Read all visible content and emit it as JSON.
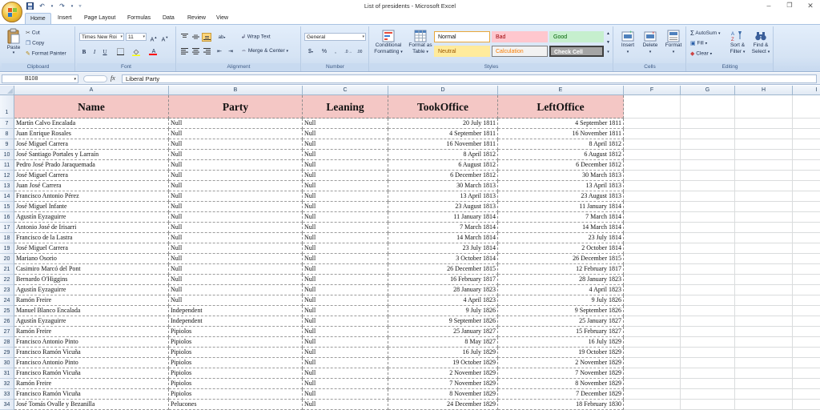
{
  "app": {
    "title": "List of presidents - Microsoft Excel"
  },
  "qat": {
    "save_icon": "save-icon",
    "undo_icon": "undo-icon",
    "redo_icon": "redo-icon"
  },
  "tabs": [
    "Home",
    "Insert",
    "Page Layout",
    "Formulas",
    "Data",
    "Review",
    "View"
  ],
  "ribbon": {
    "clipboard": {
      "label": "Clipboard",
      "paste": "Paste",
      "cut": "Cut",
      "copy": "Copy",
      "format_painter": "Format Painter"
    },
    "font": {
      "label": "Font",
      "font_name": "Times New Roi",
      "font_size": "11"
    },
    "alignment": {
      "label": "Alignment",
      "wrap_text": "Wrap Text",
      "merge_center": "Merge & Center"
    },
    "number": {
      "label": "Number",
      "format": "General"
    },
    "styles": {
      "label": "Styles",
      "conditional_formatting_1": "Conditional",
      "conditional_formatting_2": "Formatting",
      "format_as_table_1": "Format as",
      "format_as_table_2": "Table",
      "normal": "Normal",
      "bad": "Bad",
      "good": "Good",
      "neutral": "Neutral",
      "calculation": "Calculation",
      "check_cell": "Check Cell"
    },
    "cells": {
      "label": "Cells",
      "insert": "Insert",
      "delete": "Delete",
      "format": "Format"
    },
    "editing": {
      "label": "Editing",
      "autosum": "AutoSum",
      "fill": "Fill",
      "clear": "Clear",
      "sort_filter_1": "Sort &",
      "sort_filter_2": "Filter",
      "find_select_1": "Find &",
      "find_select_2": "Select"
    }
  },
  "formula_bar": {
    "name_box": "B108",
    "fx": "fx",
    "value": "Liberal Party"
  },
  "sheet": {
    "columns": [
      "A",
      "B",
      "C",
      "D",
      "E",
      "F",
      "G",
      "H",
      "I"
    ],
    "header_row_number": "1",
    "headers": [
      "Name",
      "Party",
      "Leaning",
      "TookOffice",
      "LeftOffice"
    ],
    "rows": [
      {
        "n": "7",
        "c": [
          "Martín Calvo Encalada",
          "Null",
          "Null",
          "20 July 1811",
          "4 September 1811"
        ]
      },
      {
        "n": "8",
        "c": [
          "Juan Enrique Rosales",
          "Null",
          "Null",
          "4 September 1811",
          "16 November 1811"
        ]
      },
      {
        "n": "9",
        "c": [
          "José Miguel Carrera",
          "Null",
          "Null",
          "16 November 1811",
          "8 April 1812"
        ]
      },
      {
        "n": "10",
        "c": [
          "José Santiago Portales y Larraín",
          "Null",
          "Null",
          "8 April 1812",
          "6 August 1812"
        ]
      },
      {
        "n": "11",
        "c": [
          "Pedro José Prado Jaraquemada",
          "Null",
          "Null",
          "6 August 1812",
          "6 December 1812"
        ]
      },
      {
        "n": "12",
        "c": [
          "José Miguel Carrera",
          "Null",
          "Null",
          "6 December 1812",
          "30 March 1813"
        ]
      },
      {
        "n": "13",
        "c": [
          "Juan José Carrera",
          "Null",
          "Null",
          "30 March 1813",
          "13 April 1813"
        ]
      },
      {
        "n": "14",
        "c": [
          "Francisco Antonio Pérez",
          "Null",
          "Null",
          "13 April 1813",
          "23 August 1813"
        ]
      },
      {
        "n": "15",
        "c": [
          "José Miguel Infante",
          "Null",
          "Null",
          "23 August 1813",
          "11 January 1814"
        ]
      },
      {
        "n": "16",
        "c": [
          "Agustín Eyzaguirre",
          "Null",
          "Null",
          "11 January 1814",
          "7 March 1814"
        ]
      },
      {
        "n": "17",
        "c": [
          "Antonio José de Irisarri",
          "Null",
          "Null",
          "7 March 1814",
          "14 March 1814"
        ]
      },
      {
        "n": "18",
        "c": [
          "Francisco de la Lastra",
          "Null",
          "Null",
          "14 March 1814",
          "23 July 1814"
        ]
      },
      {
        "n": "19",
        "c": [
          "José Miguel Carrera",
          "Null",
          "Null",
          "23 July 1814",
          "2 October 1814"
        ]
      },
      {
        "n": "20",
        "c": [
          "Mariano Osorio",
          "Null",
          "Null",
          "3 October 1814",
          "26 December 1815"
        ]
      },
      {
        "n": "21",
        "c": [
          "Casimiro Marcó del Pont",
          "Null",
          "Null",
          "26 December 1815",
          "12 February 1817"
        ]
      },
      {
        "n": "22",
        "c": [
          "Bernardo O'Higgins",
          "Null",
          "Null",
          "16 February 1817",
          "28 January 1823"
        ]
      },
      {
        "n": "23",
        "c": [
          "Agustín Eyzaguirre",
          "Null",
          "Null",
          "28 January 1823",
          "4 April 1823"
        ]
      },
      {
        "n": "24",
        "c": [
          "Ramón Freire",
          "Null",
          "Null",
          "4 April 1823",
          "9 July 1826"
        ]
      },
      {
        "n": "25",
        "c": [
          "Manuel Blanco Encalada",
          "Independent",
          "Null",
          "9 July 1826",
          "9 September 1826"
        ]
      },
      {
        "n": "26",
        "c": [
          "Agustín Eyzaguirre",
          "Independent",
          "Null",
          "9 September 1826",
          "25 January 1827"
        ]
      },
      {
        "n": "27",
        "c": [
          "Ramón Freire",
          "Pipiolos",
          "Null",
          "25 January 1827",
          "15 February 1827"
        ]
      },
      {
        "n": "28",
        "c": [
          "Francisco Antonio Pinto",
          "Pipiolos",
          "Null",
          "8 May 1827",
          "16 July 1829"
        ]
      },
      {
        "n": "29",
        "c": [
          "Francisco Ramón Vicuña",
          "Pipiolos",
          "Null",
          "16 July 1829",
          "19 October 1829"
        ]
      },
      {
        "n": "30",
        "c": [
          "Francisco Antonio Pinto",
          "Pipiolos",
          "Null",
          "19 October 1829",
          "2 November 1829"
        ]
      },
      {
        "n": "31",
        "c": [
          "Francisco Ramón Vicuña",
          "Pipiolos",
          "Null",
          "2 November 1829",
          "7 November 1829"
        ]
      },
      {
        "n": "32",
        "c": [
          "Ramón Freire",
          "Pipiolos",
          "Null",
          "7 November 1829",
          "8 November 1829"
        ]
      },
      {
        "n": "33",
        "c": [
          "Francisco Ramón Vicuña",
          "Pipiolos",
          "Null",
          "8 November 1829",
          "7 December 1829"
        ]
      },
      {
        "n": "34",
        "c": [
          "José Tomás Ovalle y Bezanilla",
          "Pelucones",
          "Null",
          "24 December 1829",
          "18 February 1830"
        ]
      }
    ]
  },
  "colors": {
    "header_fill": "#f4c7c5",
    "ribbon_bg": "#dbe6f4",
    "bad_fill": "#ffc7ce",
    "bad_text": "#9c0006",
    "good_fill": "#c6efce",
    "good_text": "#006100",
    "neutral_fill": "#ffeb9c",
    "neutral_text": "#9c5700",
    "calc_fill": "#f2f2f2",
    "calc_text": "#fa7d00",
    "check_fill": "#a5a5a5"
  }
}
